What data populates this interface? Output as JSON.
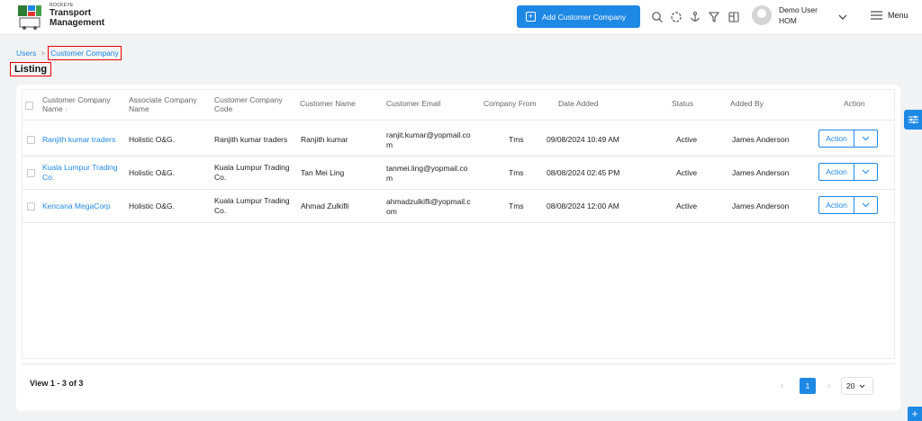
{
  "brand": {
    "top": "ROCKEYE",
    "line1": "Transport",
    "line2": "Management"
  },
  "header": {
    "add_button": "Add Customer Company",
    "icons": [
      "search-icon",
      "loader-icon",
      "anchor-icon",
      "filter-icon",
      "book-icon"
    ],
    "user_name": "Demo User",
    "user_role": "HOM",
    "menu_label": "Menu"
  },
  "breadcrumb": {
    "parent": "Users",
    "current": "Customer Company"
  },
  "page_title": "Listing",
  "table": {
    "headers": {
      "customer_company_name": "Customer Company Name",
      "associate_company_name": "Associate Company Name",
      "customer_company_code": "Customer Company Code",
      "customer_name": "Customer Name",
      "customer_email": "Customer Email",
      "company_from": "Company From",
      "date_added": "Date Added",
      "status": "Status",
      "added_by": "Added By",
      "action": "Action"
    },
    "rows": [
      {
        "customer_company_name": "Ranjith kumar traders",
        "associate_company_name": "Holistic O&G.",
        "customer_company_code": "Ranjith kumar traders",
        "customer_name": "Ranjith kumar",
        "customer_email": "ranjit.kumar@yopmail.com",
        "company_from": "Tms",
        "date_added": "09/08/2024 10:49 AM",
        "status": "Active",
        "added_by": "James Anderson",
        "action": "Action"
      },
      {
        "customer_company_name": "Kuala Lumpur Trading Co.",
        "associate_company_name": "Holistic O&G.",
        "customer_company_code": "Kuala Lumpur Trading Co.",
        "customer_name": "Tan Mei Ling",
        "customer_email": "tanmei.ling@yopmail.com",
        "company_from": "Tms",
        "date_added": "08/08/2024 02:45 PM",
        "status": "Active",
        "added_by": "James Anderson",
        "action": "Action"
      },
      {
        "customer_company_name": "Kencana MegaCorp",
        "associate_company_name": "Holistic O&G.",
        "customer_company_code": "Kuala Lumpur Trading Co.",
        "customer_name": "Ahmad Zulkifli",
        "customer_email": "ahmadzulkifli@yopmail.com",
        "company_from": "Tms",
        "date_added": "08/08/2024 12:00 AM",
        "status": "Active",
        "added_by": "James Anderson",
        "action": "Action"
      }
    ]
  },
  "pagination": {
    "view_count": "View 1 - 3 of 3",
    "current_page": "1",
    "page_size": "20"
  },
  "colors": {
    "primary": "#1e88e5",
    "highlight": "#ee0000",
    "background": "#f2f3f5"
  }
}
